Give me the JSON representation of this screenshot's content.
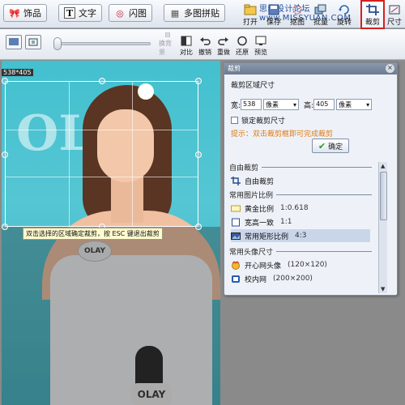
{
  "toolbar": {
    "buttons": [
      {
        "label": "饰品",
        "icon": "bow-icon"
      },
      {
        "label": "文字",
        "icon": "text-icon"
      },
      {
        "label": "闪图",
        "icon": "flash-icon"
      },
      {
        "label": "多图拼贴",
        "icon": "collage-icon"
      }
    ],
    "tools": [
      {
        "label": "打开",
        "icon": "open-icon"
      },
      {
        "label": "保存",
        "icon": "save-icon"
      },
      {
        "label": "抠图",
        "icon": "cutout-icon"
      },
      {
        "label": "批量",
        "icon": "batch-icon"
      },
      {
        "label": "旋转",
        "icon": "rotate-icon"
      },
      {
        "label": "裁剪",
        "icon": "crop-icon"
      },
      {
        "label": "尺寸",
        "icon": "resize-icon"
      }
    ],
    "watermark": "思缘设计论坛 www.MISSYUAN.COM"
  },
  "toolbar2": {
    "tools": [
      {
        "label": "换背景",
        "disabled": true
      },
      {
        "label": "对比",
        "disabled": false
      },
      {
        "label": "撤销",
        "disabled": false
      },
      {
        "label": "重做",
        "disabled": false
      },
      {
        "label": "还原",
        "disabled": false
      },
      {
        "label": "预览",
        "disabled": false
      }
    ]
  },
  "canvas": {
    "size_readout": "538*405",
    "hint": "双击选择的区域确定裁剪，按 ESC 键退出裁剪",
    "badge_text": "OLAY",
    "mic_text": "OLAY",
    "backdrop_text": "OLAY"
  },
  "panel": {
    "title": "裁剪",
    "section_title": "裁剪区域尺寸",
    "width_label": "宽:",
    "width_value": "538",
    "width_unit": "像素",
    "height_label": "高:",
    "height_value": "405",
    "height_unit": "像素",
    "lock_label": "锁定裁剪尺寸",
    "tip": "提示：双击裁剪框即可完成裁剪",
    "ok_label": "确定",
    "groups": [
      {
        "title": "自由裁剪",
        "items": [
          {
            "label": "自由裁剪",
            "value": "",
            "icon": "free-crop-icon"
          }
        ]
      },
      {
        "title": "常用图片比例",
        "items": [
          {
            "label": "黄金比例",
            "value": "1:0.618",
            "icon": "golden-ratio-icon"
          },
          {
            "label": "宽高一致",
            "value": "1:1",
            "icon": "square-ratio-icon"
          },
          {
            "label": "常用矩形比例",
            "value": "4:3",
            "icon": "rect-ratio-icon",
            "selected": true
          }
        ]
      },
      {
        "title": "常用头像尺寸",
        "items": [
          {
            "label": "开心网头像",
            "value": "(120×120)",
            "icon": "kaixin-icon"
          },
          {
            "label": "校内网",
            "value": "(200×200)",
            "icon": "xiaonei-icon"
          }
        ]
      }
    ]
  }
}
